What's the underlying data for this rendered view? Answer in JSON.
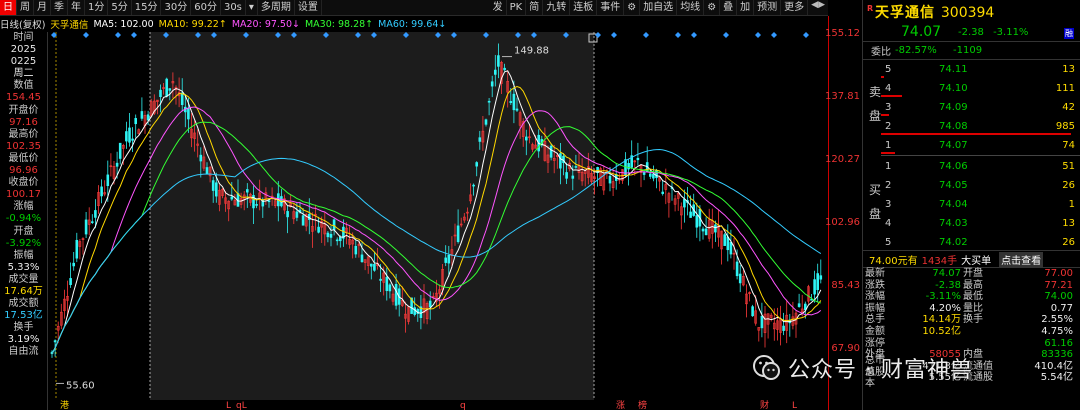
{
  "toolbar": {
    "left_items": [
      "日",
      "周",
      "月",
      "季",
      "年",
      "1分",
      "5分",
      "15分",
      "30分",
      "60分",
      "30s",
      "",
      "多周期",
      "设置"
    ],
    "active_index": 0,
    "right_items": [
      "发",
      "PK",
      "简",
      "九转",
      "连板",
      "事件",
      "",
      "加自选",
      "均线",
      "",
      "叠",
      "加",
      "预测",
      "更多"
    ]
  },
  "maline": {
    "label": "日线(复权)",
    "ma": [
      {
        "text": "MA5: 102.00",
        "color": "#ffffff"
      },
      {
        "text": "MA10: 99.22↑",
        "color": "#ffd800"
      },
      {
        "text": "MA20: 97.50↓",
        "color": "#ff55ff"
      },
      {
        "text": "MA30: 98.28↑",
        "color": "#33ff33"
      },
      {
        "text": "MA60: 99.64↓",
        "color": "#33ccff"
      }
    ]
  },
  "stock_name_short": "天孚通信",
  "left_panel": [
    {
      "lbl": "时间",
      "val": "2025"
    },
    {
      "lbl": "",
      "val": "0225"
    },
    {
      "lbl": "",
      "val": "周二"
    },
    {
      "lbl": "数值",
      "val": "154.45",
      "color": "#e33"
    },
    {
      "lbl": "开盘价",
      "val": "97.16",
      "color": "#e33"
    },
    {
      "lbl": "最高价",
      "val": "102.35",
      "color": "#e33"
    },
    {
      "lbl": "最低价",
      "val": "96.96",
      "color": "#e33"
    },
    {
      "lbl": "收盘价",
      "val": "100.17",
      "color": "#e33"
    },
    {
      "lbl": "涨幅",
      "val": "-0.94%",
      "color": "#0c0"
    },
    {
      "lbl": "开盘",
      "val": "-3.92%",
      "color": "#0c0"
    },
    {
      "lbl": "振幅",
      "val": "5.33%",
      "color": "#eee"
    },
    {
      "lbl": "成交量",
      "val": "17.64万",
      "color": "#ffdc00"
    },
    {
      "lbl": "成交额",
      "val": "17.53亿",
      "color": "#33ccff"
    },
    {
      "lbl": "换手",
      "val": "3.19%",
      "color": "#eee"
    },
    {
      "lbl": "自由流",
      "val": "",
      "color": "#eee"
    }
  ],
  "price_scale": [
    "155.12",
    "137.81",
    "120.27",
    "102.96",
    "85.43",
    "67.90"
  ],
  "annotations": {
    "high": "149.88",
    "low": "55.60"
  },
  "bottom_marks": [
    "港",
    "L",
    "qL",
    "q",
    "涨",
    "榜",
    "财",
    "L"
  ],
  "quote": {
    "r": "R",
    "name": "天孚通信",
    "code": "300394",
    "price": "74.07",
    "change": "-2.38",
    "pct": "-3.11%",
    "badge": "融",
    "weibi_label": "委比",
    "weibi_pct": "-82.57%",
    "weibi_diff": "-1109",
    "sell_label": "卖盘",
    "buy_label": "买盘",
    "asks": [
      {
        "lvl": "5",
        "price": "74.11",
        "vol": "13"
      },
      {
        "lvl": "4",
        "price": "74.10",
        "vol": "111"
      },
      {
        "lvl": "3",
        "price": "74.09",
        "vol": "42"
      },
      {
        "lvl": "2",
        "price": "74.08",
        "vol": "985"
      },
      {
        "lvl": "1",
        "price": "74.07",
        "vol": "74"
      }
    ],
    "bids": [
      {
        "lvl": "1",
        "price": "74.06",
        "vol": "51"
      },
      {
        "lvl": "2",
        "price": "74.05",
        "vol": "26"
      },
      {
        "lvl": "3",
        "price": "74.04",
        "vol": "1"
      },
      {
        "lvl": "4",
        "price": "74.03",
        "vol": "13"
      },
      {
        "lvl": "5",
        "price": "74.02",
        "vol": "26"
      }
    ],
    "bigorder": {
      "a": "74.00元有",
      "b": "1434手",
      "c": "大买单",
      "d": "点击查看"
    },
    "stats": [
      {
        "l1": "最新",
        "v1": "74.07",
        "c1": "grn",
        "l2": "开盘",
        "v2": "77.00",
        "c2": "red"
      },
      {
        "l1": "涨跌",
        "v1": "-2.38",
        "c1": "grn",
        "l2": "最高",
        "v2": "77.21",
        "c2": "red"
      },
      {
        "l1": "涨幅",
        "v1": "-3.11%",
        "c1": "grn",
        "l2": "最低",
        "v2": "74.00",
        "c2": "grn"
      },
      {
        "l1": "振幅",
        "v1": "4.20%",
        "c1": "wht",
        "l2": "量比",
        "v2": "0.77",
        "c2": "wht"
      },
      {
        "l1": "总手",
        "v1": "14.14万",
        "c1": "yel",
        "l2": "换手",
        "v2": "2.55%",
        "c2": "wht"
      },
      {
        "l1": "金额",
        "v1": "10.52亿",
        "c1": "yel",
        "l2": "",
        "v2": "4.75%",
        "c2": "wht"
      },
      {
        "l1": "涨停",
        "v1": "",
        "c1": "red",
        "l2": "",
        "v2": "61.16",
        "c2": "grn"
      },
      {
        "l1": "外盘",
        "v1": "58055",
        "c1": "red",
        "l2": "内盘",
        "v2": "83336",
        "c2": "grn"
      },
      {
        "l1": "总市值",
        "v1": "411.3亿",
        "c1": "wht",
        "l2": "流通值",
        "v2": "410.4亿",
        "c2": "wht"
      },
      {
        "l1": "总股本",
        "v1": "5.55亿",
        "c1": "wht",
        "l2": "流通股",
        "v2": "5.54亿",
        "c2": "wht"
      }
    ]
  },
  "watermark": {
    "text": "公众号 · 财富神兽"
  }
}
